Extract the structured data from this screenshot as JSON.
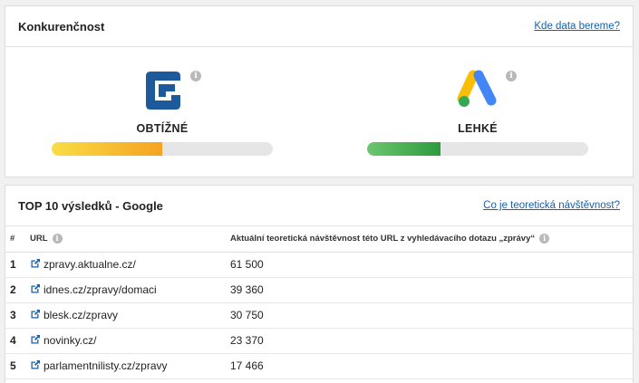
{
  "competition": {
    "title": "Konkurenčnost",
    "link": "Kde data bereme?",
    "metrics": [
      {
        "label": "OBTÍŽNÉ",
        "level": 0.5,
        "fill_color": "#f7a822",
        "icon": "seznam-logo-icon"
      },
      {
        "label": "LEHKÉ",
        "level": 0.33,
        "fill_color": "#46a64f",
        "icon": "google-ads-logo-icon"
      }
    ]
  },
  "top10": {
    "title": "TOP 10 výsledků - Google",
    "link": "Co je teoretická návštěvnost?",
    "columns": {
      "num": "#",
      "url": "URL",
      "traffic": "Aktuální teoretická návštěvnost této URL z vyhledávacího dotazu „zprávy“"
    },
    "rows": [
      {
        "num": "1",
        "url": "zpravy.aktualne.cz/",
        "traffic": "61 500"
      },
      {
        "num": "2",
        "url": "idnes.cz/zpravy/domaci",
        "traffic": "39 360"
      },
      {
        "num": "3",
        "url": "blesk.cz/zpravy",
        "traffic": "30 750"
      },
      {
        "num": "4",
        "url": "novinky.cz/",
        "traffic": "23 370"
      },
      {
        "num": "5",
        "url": "parlamentnilisty.cz/zpravy",
        "traffic": "17 466"
      }
    ]
  }
}
